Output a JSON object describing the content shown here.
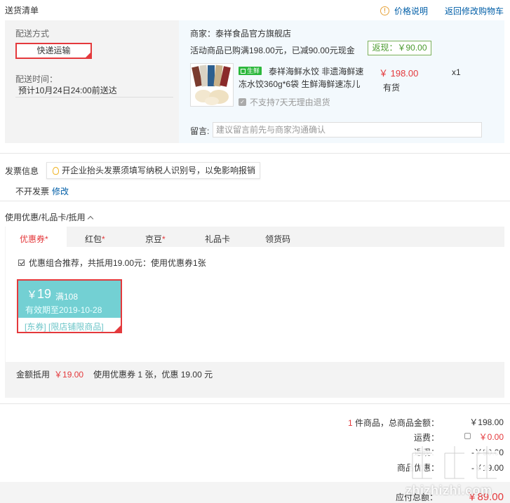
{
  "header": {
    "title": "送货清单",
    "price_note": "价格说明",
    "back_to_cart": "返回修改购物车"
  },
  "shipping": {
    "method_label": "配送方式",
    "method_value": "快递运输",
    "time_label": "配送时间：",
    "time_value": "预计10月24日24:00前送达"
  },
  "store": {
    "name": "商家：泰祥食品官方旗舰店",
    "promo": "活动商品已购满198.00元，已减90.00元现金",
    "rebate": "返现：￥90.00",
    "product": {
      "tag": "生鲜",
      "name": "泰祥海鲜水饺 非遗海鲜速冻水饺360g*6袋 生鲜海鲜速冻儿",
      "price": "￥ 198.00",
      "stock": "有货",
      "qty": "x1",
      "no_return": "不支持7天无理由退货"
    },
    "message_label": "留言:",
    "message_placeholder": "建议留言前先与商家沟通确认"
  },
  "invoice": {
    "title": "发票信息",
    "tip": "开企业抬头发票须填写纳税人识别号，以免影响报销",
    "value": "不开发票",
    "edit": "修改"
  },
  "coupons": {
    "title": "使用优惠/礼品卡/抵用",
    "tabs": [
      {
        "label": "优惠券",
        "star": "*"
      },
      {
        "label": "红包",
        "star": "*"
      },
      {
        "label": "京豆",
        "star": "*"
      },
      {
        "label": "礼品卡",
        "star": ""
      },
      {
        "label": "领货码",
        "star": ""
      }
    ],
    "combo_text": "优惠组合推荐，共抵用19.00元：使用优惠券1张",
    "card": {
      "currency": "￥",
      "amount": "19",
      "condition": "满108",
      "expiry": "有效期至2019-10-28",
      "scope": "[东券] [限店铺限商品]"
    },
    "summary_label": "金额抵用",
    "summary_amount": "￥19.00",
    "summary_text": "使用优惠券 1 张，优惠 19.00 元"
  },
  "totals": {
    "items_count": "1",
    "items_label": " 件商品，总商品金额：",
    "items_value": "￥198.00",
    "freight_label": "运费：",
    "freight_value": "￥0.00",
    "row3_label": "返现：",
    "row3_value": "-￥90.00",
    "row4_label": "商品优惠：",
    "row4_value": "-￥19.00",
    "pay_label": "应付总额：",
    "pay_value": "￥89.00"
  },
  "watermark": "zhizhizhi.com"
}
